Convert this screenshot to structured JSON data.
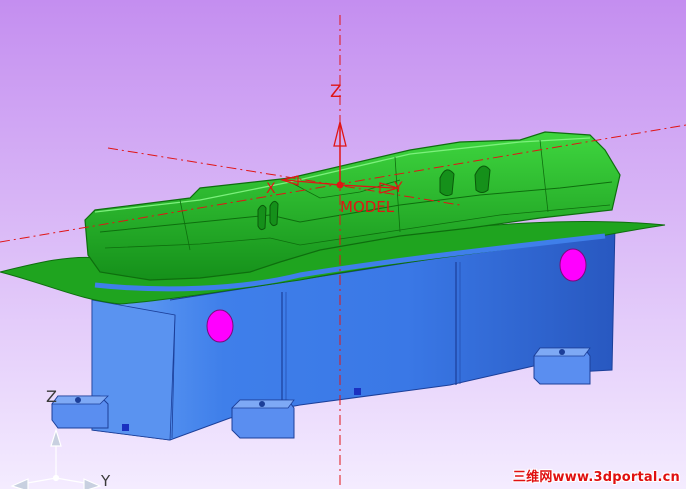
{
  "viewport": {
    "background_top": "#c48ef0",
    "background_bottom": "#f4ecff",
    "model_axes": {
      "z_label": "Z",
      "x_label": "X",
      "y_label": "Y",
      "name": "MODEL"
    },
    "view_triad": {
      "z_label": "Z",
      "y_label": "Y"
    },
    "watermark": "三维网www.3dportal.cn"
  },
  "colors": {
    "axis_red": "#e01515",
    "mold_green": "#1fa41f",
    "mold_green_light": "#3fd63f",
    "mold_green_dark": "#0e6e0e",
    "base_blue": "#3f7fea",
    "base_blue_dark": "#2858c0",
    "base_blue_light": "#6aa3f5",
    "hole_magenta": "#ff00ff",
    "block_blue": "#5a8ef0",
    "triad_gray": "#c8d0e0"
  }
}
